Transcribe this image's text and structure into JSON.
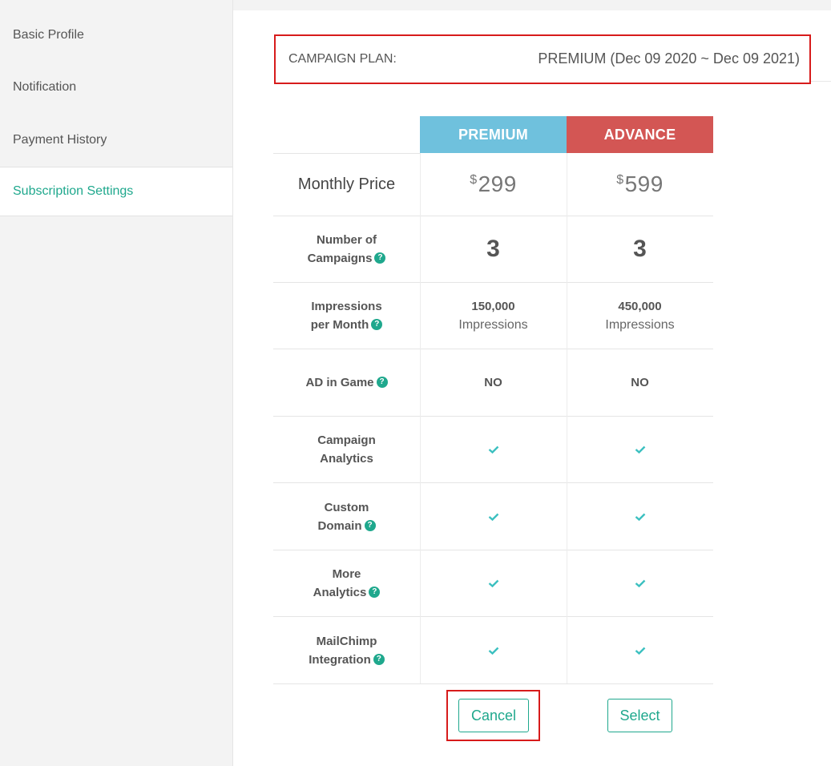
{
  "sidebar": {
    "items": [
      {
        "label": "Basic Profile",
        "active": false
      },
      {
        "label": "Notification",
        "active": false
      },
      {
        "label": "Payment History",
        "active": false
      },
      {
        "label": "Subscription Settings",
        "active": true
      }
    ]
  },
  "campaign_plan": {
    "label": "CAMPAIGN PLAN:",
    "value": "PREMIUM (Dec 09 2020 ~ Dec 09 2021)"
  },
  "plans": {
    "premium": {
      "name": "PREMIUM",
      "color": "#6fc1dd",
      "currency": "$",
      "price": "299",
      "campaigns": "3",
      "impressions": "150,000",
      "impressions_label": "Impressions",
      "ad_in_game": "NO",
      "button": "Cancel"
    },
    "advance": {
      "name": "ADVANCE",
      "color": "#d35654",
      "currency": "$",
      "price": "599",
      "campaigns": "3",
      "impressions": "450,000",
      "impressions_label": "Impressions",
      "ad_in_game": "NO",
      "button": "Select"
    }
  },
  "features": {
    "monthly_price": "Monthly Price",
    "campaigns_l1": "Number of",
    "campaigns_l2": "Campaigns",
    "impressions_l1": "Impressions",
    "impressions_l2": "per Month",
    "ad_in_game": "AD in Game",
    "analytics_l1": "Campaign",
    "analytics_l2": "Analytics",
    "domain_l1": "Custom",
    "domain_l2": "Domain",
    "more_l1": "More",
    "more_l2": "Analytics",
    "mailchimp_l1": "MailChimp",
    "mailchimp_l2": "Integration"
  },
  "colors": {
    "accent": "#1fa88d",
    "highlight_border": "#d71b1b",
    "check": "#3cc0c0"
  },
  "icons": {
    "help": "question-circle-icon",
    "check": "check-icon"
  }
}
